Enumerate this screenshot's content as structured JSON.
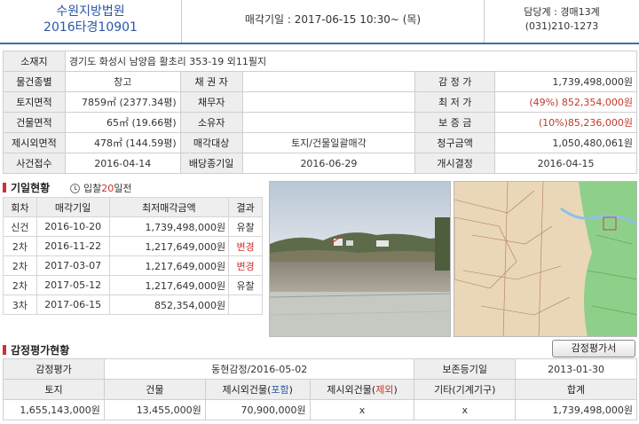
{
  "header": {
    "court": "수원지방법원",
    "case_no": "2016타경10901",
    "auction_date": "매각기일 : 2017-06-15   10:30~ (목)",
    "manager": "담당계 : 경매13계",
    "phone": "(031)210-1273"
  },
  "info": {
    "location_label": "소재지",
    "location": "경기도 화성시 남양읍 활초리 353-19 외11필지",
    "type_label": "물건종별",
    "type": "창고",
    "creditor_label": "채 권 자",
    "creditor": "",
    "appraisal_label": "감 정 가",
    "appraisal": "1,739,498,000원",
    "land_area_label": "토지면적",
    "land_area": "7859㎡ (2377.34평)",
    "debtor_label": "채무자",
    "debtor": "",
    "min_price_label": "최 저 가",
    "min_price": "(49%) 852,354,000원",
    "bldg_area_label": "건물면적",
    "bldg_area": "65㎡ (19.66평)",
    "owner_label": "소유자",
    "owner": "",
    "deposit_label": "보 증 금",
    "deposit": "(10%)85,236,000원",
    "excluded_area_label": "제시외면적",
    "excluded_area": "478㎡ (144.59평)",
    "sale_target_label": "매각대상",
    "sale_target": "토지/건물일괄매각",
    "claim_label": "청구금액",
    "claim": "1,050,480,061원",
    "received_label": "사건접수",
    "received": "2016-04-14",
    "dividend_label": "배당종기일",
    "dividend": "2016-06-29",
    "start_label": "개시결정",
    "start": "2016-04-15"
  },
  "bid_section": {
    "title": "기일현황",
    "note_prefix": "입찰",
    "note_days": "20",
    "note_suffix": "일전",
    "headers": [
      "회차",
      "매각기일",
      "최저매각금액",
      "결과"
    ],
    "rows": [
      {
        "round": "신건",
        "date": "2016-10-20",
        "amount": "1,739,498,000원",
        "result": "유찰",
        "red": false
      },
      {
        "round": "2차",
        "date": "2016-11-22",
        "amount": "1,217,649,000원",
        "result": "변경",
        "red": true
      },
      {
        "round": "2차",
        "date": "2017-03-07",
        "amount": "1,217,649,000원",
        "result": "변경",
        "red": true
      },
      {
        "round": "2차",
        "date": "2017-05-12",
        "amount": "1,217,649,000원",
        "result": "유찰",
        "red": false
      },
      {
        "round": "3차",
        "date": "2017-06-15",
        "amount": "852,354,000원",
        "result": "",
        "red": false
      }
    ]
  },
  "appraisal_section": {
    "title": "감정평가현황",
    "button": "감정평가서",
    "row1": {
      "label": "감정평가",
      "appraiser": "동현감정/2016-05-02",
      "base_date_label": "보존등기일",
      "base_date": "2013-01-30"
    },
    "headers": {
      "land": "토지",
      "building": "건물",
      "incl_prefix": "제시외건물(",
      "incl_word": "포함",
      "incl_suffix": ")",
      "excl_prefix": "제시외건물(",
      "excl_word": "제외",
      "excl_suffix": ")",
      "other": "기타(기계기구)",
      "total": "합계"
    },
    "values": {
      "land": "1,655,143,000원",
      "building": "13,455,000원",
      "incl": "70,900,000원",
      "excl": "x",
      "other": "x",
      "total": "1,739,498,000원"
    }
  },
  "photo_caption": "감정평가현"
}
